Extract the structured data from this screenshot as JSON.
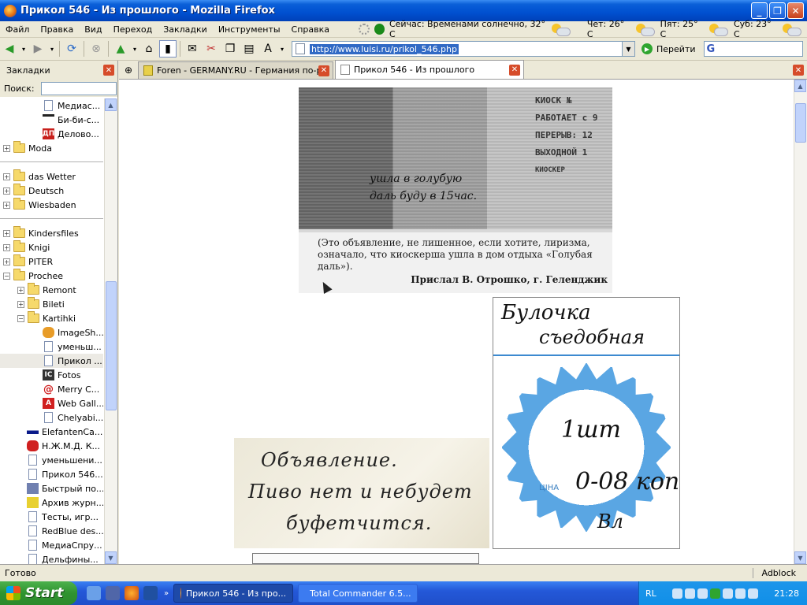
{
  "window": {
    "title": "Прикол 546 - Из прошлого - Mozilla Firefox",
    "minimize": "_",
    "maximize": "❐",
    "close": "✕"
  },
  "menu": {
    "items": [
      "Файл",
      "Правка",
      "Вид",
      "Переход",
      "Закладки",
      "Инструменты",
      "Справка"
    ]
  },
  "weather": {
    "now": "Сейчас: Временами солнечно, 32° C",
    "d1": "Чет: 26° C",
    "d2": "Пят: 25° C",
    "d3": "Суб: 23° C"
  },
  "navbar": {
    "url": "http://www.luisi.ru/prikol_546.php",
    "go_label": "Перейти"
  },
  "sidebar": {
    "title": "Закладки",
    "search_label": "Поиск:",
    "items": [
      {
        "label": "Медиас..."
      },
      {
        "label": "Би-би-с..."
      },
      {
        "label": "Делово..."
      },
      {
        "label": "Moda"
      },
      {
        "label": "das Wetter"
      },
      {
        "label": "Deutsch"
      },
      {
        "label": "Wiesbaden"
      },
      {
        "label": "Kindersfiles"
      },
      {
        "label": "Knigi"
      },
      {
        "label": "PITER"
      },
      {
        "label": "Prochee"
      },
      {
        "label": "Remont"
      },
      {
        "label": "Bileti"
      },
      {
        "label": "Kartihki"
      },
      {
        "label": "ImageSh..."
      },
      {
        "label": "уменьш..."
      },
      {
        "label": "Прикол ..."
      },
      {
        "label": "Fotos"
      },
      {
        "label": "Merry C..."
      },
      {
        "label": "Web Gall..."
      },
      {
        "label": "Chelyabi..."
      },
      {
        "label": "ElefantenCa..."
      },
      {
        "label": "Н.Ж.М.Д. К..."
      },
      {
        "label": "уменьшени..."
      },
      {
        "label": "Прикол 546..."
      },
      {
        "label": "Быстрый по..."
      },
      {
        "label": "Архив журн..."
      },
      {
        "label": "Тесты, игр..."
      },
      {
        "label": "RedBlue des..."
      },
      {
        "label": "МедиаСпру..."
      },
      {
        "label": "Дельфины..."
      }
    ]
  },
  "tabs": [
    {
      "label": "Foren - GERMANY.RU - Германия по-ру..."
    },
    {
      "label": "Прикол 546 - Из прошлого"
    }
  ],
  "content": {
    "clip1": {
      "handwriting": [
        "ушла в голубую",
        "даль буду в 15час."
      ],
      "kiosk_lines": [
        "КИОСК №",
        "РАБОТАЕТ с 9",
        "ПЕРЕРЫВ: 12",
        "ВЫХОДНОЙ 1",
        "КИОСКЕР"
      ],
      "caption": "(Это объявление, не лишенное, если хотите, лиризма, означало, что киоскерша ушла в дом отдыха «Голубая даль»).",
      "sender": "Прислал В. Отрошко, г. Геленджик"
    },
    "clip2": {
      "line1": "Булочка",
      "line2": "съедобная",
      "qty": "1шт",
      "tsina": "ЦІНА",
      "price": "0-08 коп",
      "signature": "Вл"
    },
    "clip3": {
      "lines": [
        "Объявление.",
        "Пиво нет и небудет",
        "буфетчится."
      ]
    }
  },
  "status": {
    "text": "Готово",
    "adblock": "Adblock"
  },
  "taskbar": {
    "start": "Start",
    "tasks": [
      {
        "label": "Прикол 546 - Из про..."
      },
      {
        "label": "Total Commander 6.5..."
      }
    ],
    "lang": "RL",
    "clock": "21:28"
  }
}
